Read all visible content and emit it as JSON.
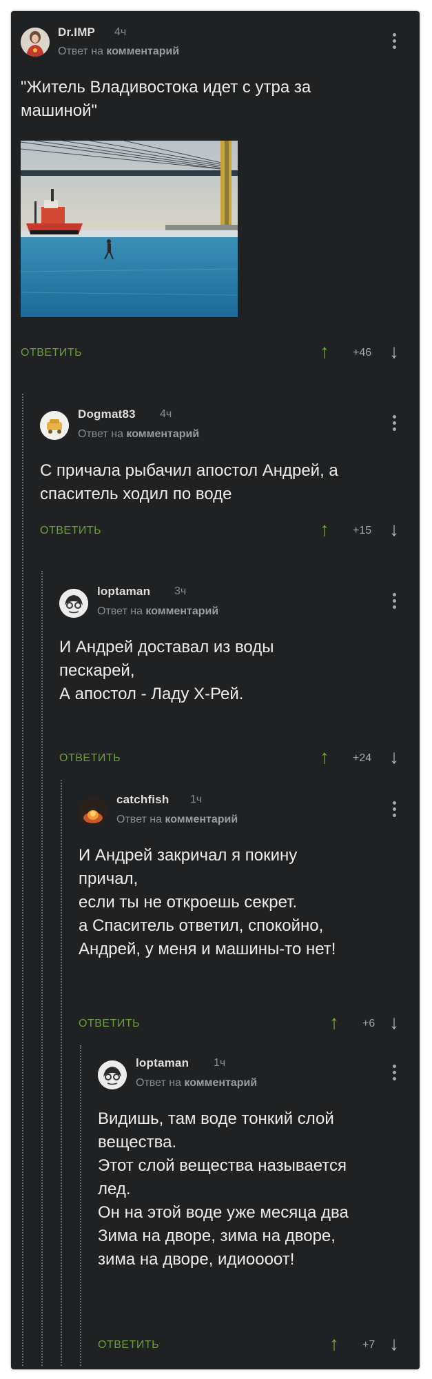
{
  "colors": {
    "background": "#1f2123",
    "accent": "#6e9d3e",
    "upvote": "#76b135"
  },
  "comments": [
    {
      "author": "Dr.IMP",
      "time": "4ч",
      "reply_prefix": "Ответ на",
      "reply_target": "комментарий",
      "lines": [
        "\"Житель Владивостока идет с утра за",
        "машиной\""
      ],
      "has_image": true,
      "reply_label": "ОТВЕТИТЬ",
      "rating": "+46"
    },
    {
      "author": "Dogmat83",
      "time": "4ч",
      "reply_prefix": "Ответ на",
      "reply_target": "комментарий",
      "lines": [
        "С причала рыбачил апостол Андрей, а",
        "спаситель ходил по воде"
      ],
      "reply_label": "ОТВЕТИТЬ",
      "rating": "+15"
    },
    {
      "author": "loptaman",
      "time": "3ч",
      "reply_prefix": "Ответ на",
      "reply_target": "комментарий",
      "lines": [
        "И Андрей доставал из воды",
        "пескарей,",
        "А апостол - Ладу Х-Рей."
      ],
      "reply_label": "ОТВЕТИТЬ",
      "rating": "+24"
    },
    {
      "author": "catchfish",
      "time": "1ч",
      "reply_prefix": "Ответ на",
      "reply_target": "комментарий",
      "lines": [
        "И Андрей закричал я покину",
        "причал,",
        "если ты не откроешь секрет.",
        "а Спаситель ответил, спокойно,",
        "Андрей, у меня и машины-то нет!"
      ],
      "reply_label": "ОТВЕТИТЬ",
      "rating": "+6"
    },
    {
      "author": "loptaman",
      "time": "1ч",
      "reply_prefix": "Ответ на",
      "reply_target": "комментарий",
      "lines": [
        "Видишь, там воде тонкий слой",
        "вещества.",
        "Этот слой вещества называется",
        "лед.",
        "Он на этой воде уже месяца два",
        "Зима на дворе, зима на дворе,",
        "зима на дворе, идиоооот!"
      ],
      "reply_label": "ОТВЕТИТЬ",
      "rating": "+7"
    }
  ]
}
